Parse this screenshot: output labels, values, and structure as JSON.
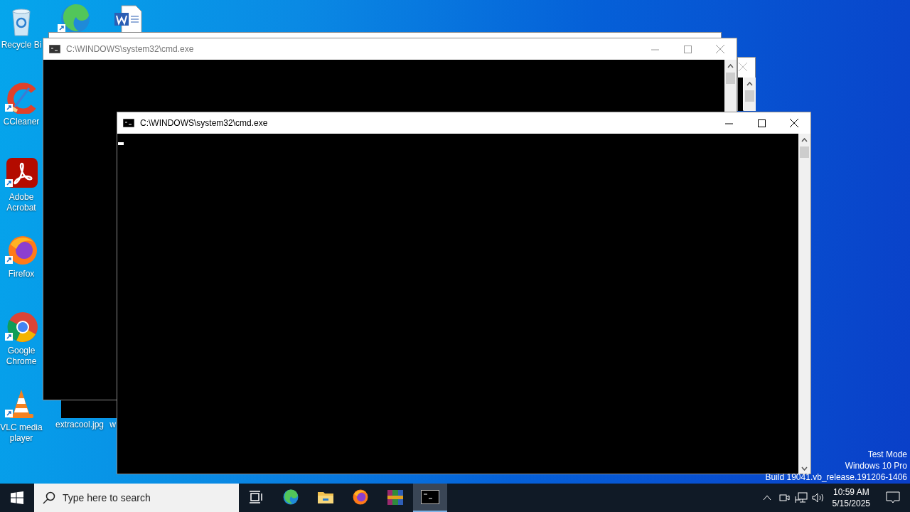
{
  "desktop_icons": [
    {
      "kind": "recycle-bin",
      "label": "Recycle Bi"
    },
    {
      "kind": "edge"
    },
    {
      "kind": "word-document"
    },
    {
      "kind": "ccleaner",
      "label": "CCleaner"
    },
    {
      "kind": "acrobat",
      "label": "Adobe Acrobat"
    },
    {
      "kind": "firefox",
      "label": "Firefox"
    },
    {
      "kind": "chrome",
      "label": "Google Chrome"
    },
    {
      "kind": "vlc",
      "label": "VLC media player"
    },
    {
      "kind": "file",
      "label": "extracool.jpg"
    },
    {
      "kind": "file",
      "label": "w"
    }
  ],
  "windows": [
    {
      "title": "C:\\WINDOWS\\system32\\cmd.exe",
      "active": false
    },
    {
      "title": "C:\\WINDOWS\\system32\\cmd.exe",
      "active": true
    }
  ],
  "system_notice": [
    "Test Mode",
    "Windows 10 Pro",
    "Build 19041.vb_release.191206-1406"
  ],
  "taskbar": {
    "search": {
      "placeholder": "Type here to search"
    },
    "apps": [
      {
        "kind": "task-view",
        "selected": false
      },
      {
        "kind": "edge",
        "selected": false
      },
      {
        "kind": "explorer",
        "selected": false
      },
      {
        "kind": "firefox",
        "selected": false
      },
      {
        "kind": "winrar",
        "selected": false
      },
      {
        "kind": "cmd",
        "selected": true
      }
    ],
    "tray": {
      "time": "10:59 AM",
      "date": "5/15/2025"
    }
  }
}
